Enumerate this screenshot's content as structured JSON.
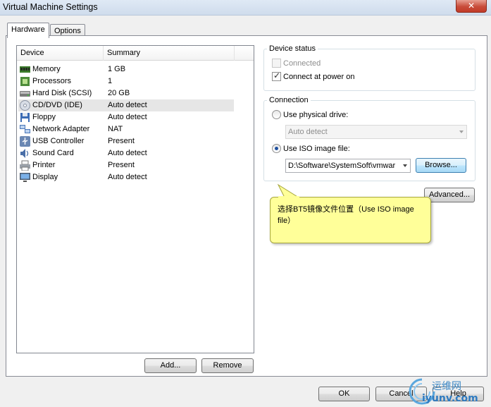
{
  "window": {
    "title": "Virtual Machine Settings",
    "close_label": "✕"
  },
  "tabs": [
    {
      "label": "Hardware",
      "active": true
    },
    {
      "label": "Options",
      "active": false
    }
  ],
  "device_list": {
    "columns": [
      "Device",
      "Summary"
    ],
    "rows": [
      {
        "name": "Memory",
        "summary": "1 GB",
        "icon": "memory-icon"
      },
      {
        "name": "Processors",
        "summary": "1",
        "icon": "processor-icon"
      },
      {
        "name": "Hard Disk (SCSI)",
        "summary": "20 GB",
        "icon": "hard-disk-icon"
      },
      {
        "name": "CD/DVD (IDE)",
        "summary": "Auto detect",
        "icon": "cd-dvd-icon",
        "selected": true
      },
      {
        "name": "Floppy",
        "summary": "Auto detect",
        "icon": "floppy-icon"
      },
      {
        "name": "Network Adapter",
        "summary": "NAT",
        "icon": "network-adapter-icon"
      },
      {
        "name": "USB Controller",
        "summary": "Present",
        "icon": "usb-icon"
      },
      {
        "name": "Sound Card",
        "summary": "Auto detect",
        "icon": "sound-card-icon"
      },
      {
        "name": "Printer",
        "summary": "Present",
        "icon": "printer-icon"
      },
      {
        "name": "Display",
        "summary": "Auto detect",
        "icon": "display-icon"
      }
    ]
  },
  "list_buttons": {
    "add": "Add...",
    "remove": "Remove"
  },
  "device_status": {
    "title": "Device status",
    "connected": {
      "label": "Connected",
      "checked": false,
      "enabled": false
    },
    "connect_at_power_on": {
      "label": "Connect at power on",
      "checked": true
    }
  },
  "connection": {
    "title": "Connection",
    "physical_drive": {
      "label": "Use physical drive:",
      "selected": false,
      "value": "Auto detect"
    },
    "iso_image": {
      "label": "Use ISO image file:",
      "selected": true,
      "value": "D:\\Software\\SystemSoft\\vmwar"
    },
    "browse": "Browse..."
  },
  "advanced_button": "Advanced...",
  "tooltip": {
    "text": "选择BT5镜像文件位置（Use ISO image file）"
  },
  "footer": {
    "ok": "OK",
    "cancel": "Cancel",
    "help": "Help"
  },
  "watermark": {
    "text": "运维网",
    "url": "iyunv.com"
  },
  "colors": {
    "tooltip_bg": "#ffff99",
    "selection_bg": "#e6e6e6",
    "accent": "#1f4f9e"
  }
}
